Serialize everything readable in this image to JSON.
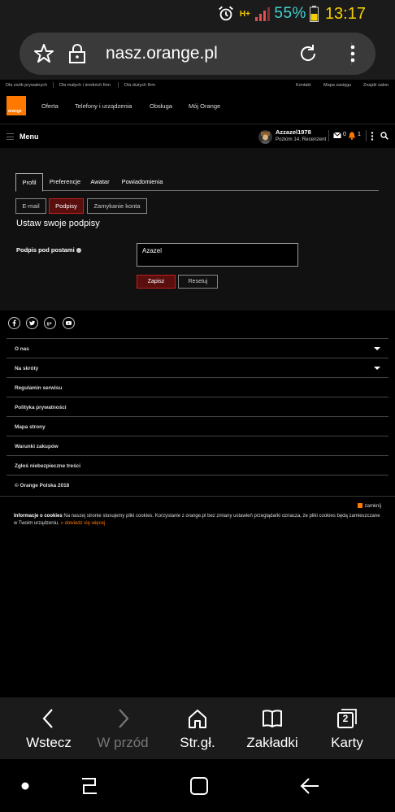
{
  "status_bar": {
    "network": "H+",
    "battery_percent": "55%",
    "time": "13:17",
    "colors": {
      "time": "#f5d000",
      "battery": "#3fd3d0"
    }
  },
  "browser": {
    "url": "nasz.orange.pl",
    "toolbar": {
      "back": "Wstecz",
      "forward": "W przód",
      "home": "Str.gł.",
      "bookmarks": "Zakładki",
      "tabs": "Karty",
      "tab_count": "2"
    }
  },
  "site": {
    "brand_color": "#ff7900",
    "logo_text": "orange",
    "top_links_left": [
      "Dla osób prywatnych",
      "Dla małych i średnich firm",
      "Dla dużych firm"
    ],
    "top_links_right": [
      "Kontakt",
      "Mapa zasięgu",
      "Znajdź salon"
    ],
    "main_nav": [
      "Oferta",
      "Telefony i urządzenia",
      "Obsługa",
      "Mój Orange"
    ],
    "menu_label": "Menu",
    "user": {
      "name": "Azzazel1978",
      "level": "Poziom 14, Recenzent",
      "messages": "0",
      "notifications": "1"
    },
    "profile_tabs": [
      "Profil",
      "Preferencje",
      "Awatar",
      "Powiadomienia"
    ],
    "active_tab": "Profil",
    "sub_tabs": [
      "E-mail",
      "Podpisy",
      "Zamykanie konta"
    ],
    "active_sub_tab": "Podpisy",
    "heading": "Ustaw swoje podpisy",
    "signature_label": "Podpis pod postami",
    "signature_value": "Azazel",
    "save_label": "Zapisz",
    "reset_label": "Resetuj"
  },
  "footer": {
    "social": [
      "facebook-icon",
      "twitter-icon",
      "google-plus-icon",
      "youtube-icon"
    ],
    "rows": [
      {
        "label": "O nas",
        "expandable": true
      },
      {
        "label": "Na skróty",
        "expandable": true
      },
      {
        "label": "Regulamin serwisu",
        "expandable": false
      },
      {
        "label": "Polityka prywatności",
        "expandable": false
      },
      {
        "label": "Mapa strony",
        "expandable": false
      },
      {
        "label": "Warunki zakupów",
        "expandable": false
      },
      {
        "label": "Zgłoś niebezpieczne treści",
        "expandable": false
      }
    ],
    "copyright": "© Orange Polska 2018"
  },
  "cookie": {
    "close_label": "zamknij",
    "title": "Informacje o cookies",
    "text": " Na naszej stronie stosujemy pliki cookies. Korzystanie z orange.pl bez zmiany ustawień przeglądarki oznacza, że pliki cookies będą zamieszczane w Twoim urządzeniu. ",
    "more_label": "dowiedz się więcej"
  }
}
